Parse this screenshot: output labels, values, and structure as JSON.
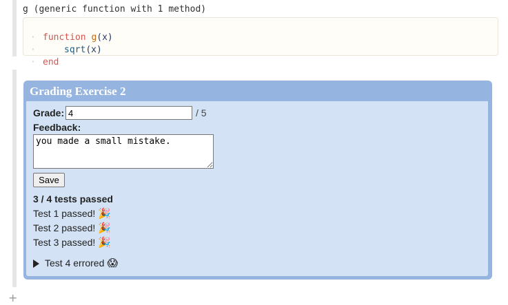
{
  "output_cell": {
    "signature": "g (generic function with 1 method)",
    "code_lines": [
      {
        "kw": "function",
        "name": "g",
        "args": "(x)"
      },
      {
        "call": "sqrt",
        "args": "(x)"
      },
      {
        "kw": "end"
      }
    ]
  },
  "grading": {
    "title": "Grading Exercise 2",
    "grade_label": "Grade:",
    "grade_value": "4",
    "out_of": "/ 5",
    "feedback_label": "Feedback:",
    "feedback_value": "you made a small mistake.",
    "save_label": "Save",
    "summary": "3 / 4 tests passed",
    "tests": [
      {
        "label": "Test 1 passed!",
        "icon": "party-popper-icon"
      },
      {
        "label": "Test 2 passed!",
        "icon": "party-popper-icon"
      },
      {
        "label": "Test 3 passed!",
        "icon": "party-popper-icon"
      }
    ],
    "errored": {
      "label": "Test 4 errored",
      "icon": "screaming-face-icon"
    }
  },
  "colors": {
    "panel_header": "#96b4e0",
    "panel_body": "#d3e2f4",
    "keyword": "#d8534f",
    "function_name": "#c16a12"
  }
}
